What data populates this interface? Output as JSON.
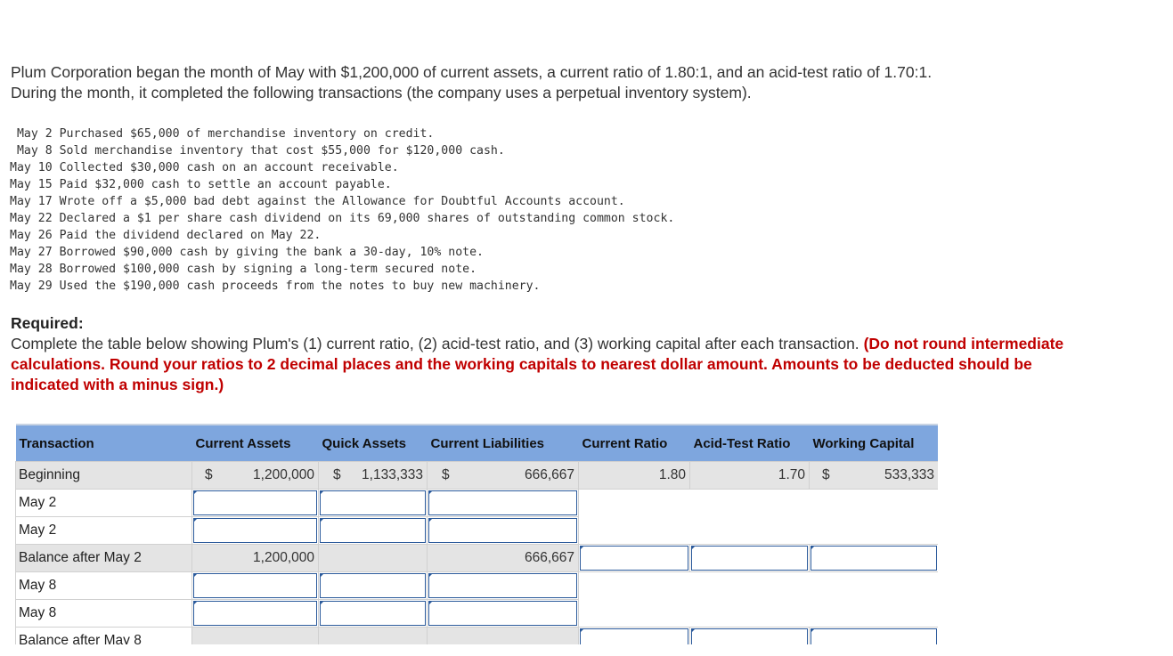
{
  "intro": {
    "line1": "Plum Corporation began the month of May with $1,200,000 of current assets, a current ratio of 1.80:1, and an acid-test ratio of 1.70:1.",
    "line2": "During the month, it completed the following transactions (the company uses a perpetual inventory system)."
  },
  "transactions": [
    " May 2 Purchased $65,000 of merchandise inventory on credit.",
    " May 8 Sold merchandise inventory that cost $55,000 for $120,000 cash.",
    "May 10 Collected $30,000 cash on an account receivable.",
    "May 15 Paid $32,000 cash to settle an account payable.",
    "May 17 Wrote off a $5,000 bad debt against the Allowance for Doubtful Accounts account.",
    "May 22 Declared a $1 per share cash dividend on its 69,000 shares of outstanding common stock.",
    "May 26 Paid the dividend declared on May 22.",
    "May 27 Borrowed $90,000 cash by giving the bank a 30-day, 10% note.",
    "May 28 Borrowed $100,000 cash by signing a long-term secured note.",
    "May 29 Used the $190,000 cash proceeds from the notes to buy new machinery."
  ],
  "required": {
    "title": "Required:",
    "text": "Complete the table below showing Plum's (1) current ratio, (2) acid-test ratio, and (3) working capital after each transaction.",
    "instruction": "(Do not round intermediate calculations. Round your ratios to 2 decimal places and the working capitals to nearest dollar amount. Amounts to be deducted should be indicated with a minus sign.)"
  },
  "table": {
    "headers": {
      "transaction": "Transaction",
      "current_assets": "Current Assets",
      "quick_assets": "Quick Assets",
      "current_liabilities": "Current Liabilities",
      "current_ratio": "Current Ratio",
      "acid_test_ratio": "Acid-Test Ratio",
      "working_capital": "Working Capital"
    },
    "currency_symbol": "$",
    "beginning": {
      "label": "Beginning",
      "current_assets": "1,200,000",
      "quick_assets": "1,133,333",
      "current_liabilities": "666,667",
      "current_ratio": "1.80",
      "acid_test_ratio": "1.70",
      "working_capital": "533,333"
    },
    "rows": {
      "may2a": "May 2",
      "may2b": "May 2",
      "balance_may2": {
        "label": "Balance after May 2",
        "current_assets": "1,200,000",
        "current_liabilities": "666,667"
      },
      "may8a": "May 8",
      "may8b": "May 8",
      "balance_may8": "Balance after May 8"
    }
  }
}
